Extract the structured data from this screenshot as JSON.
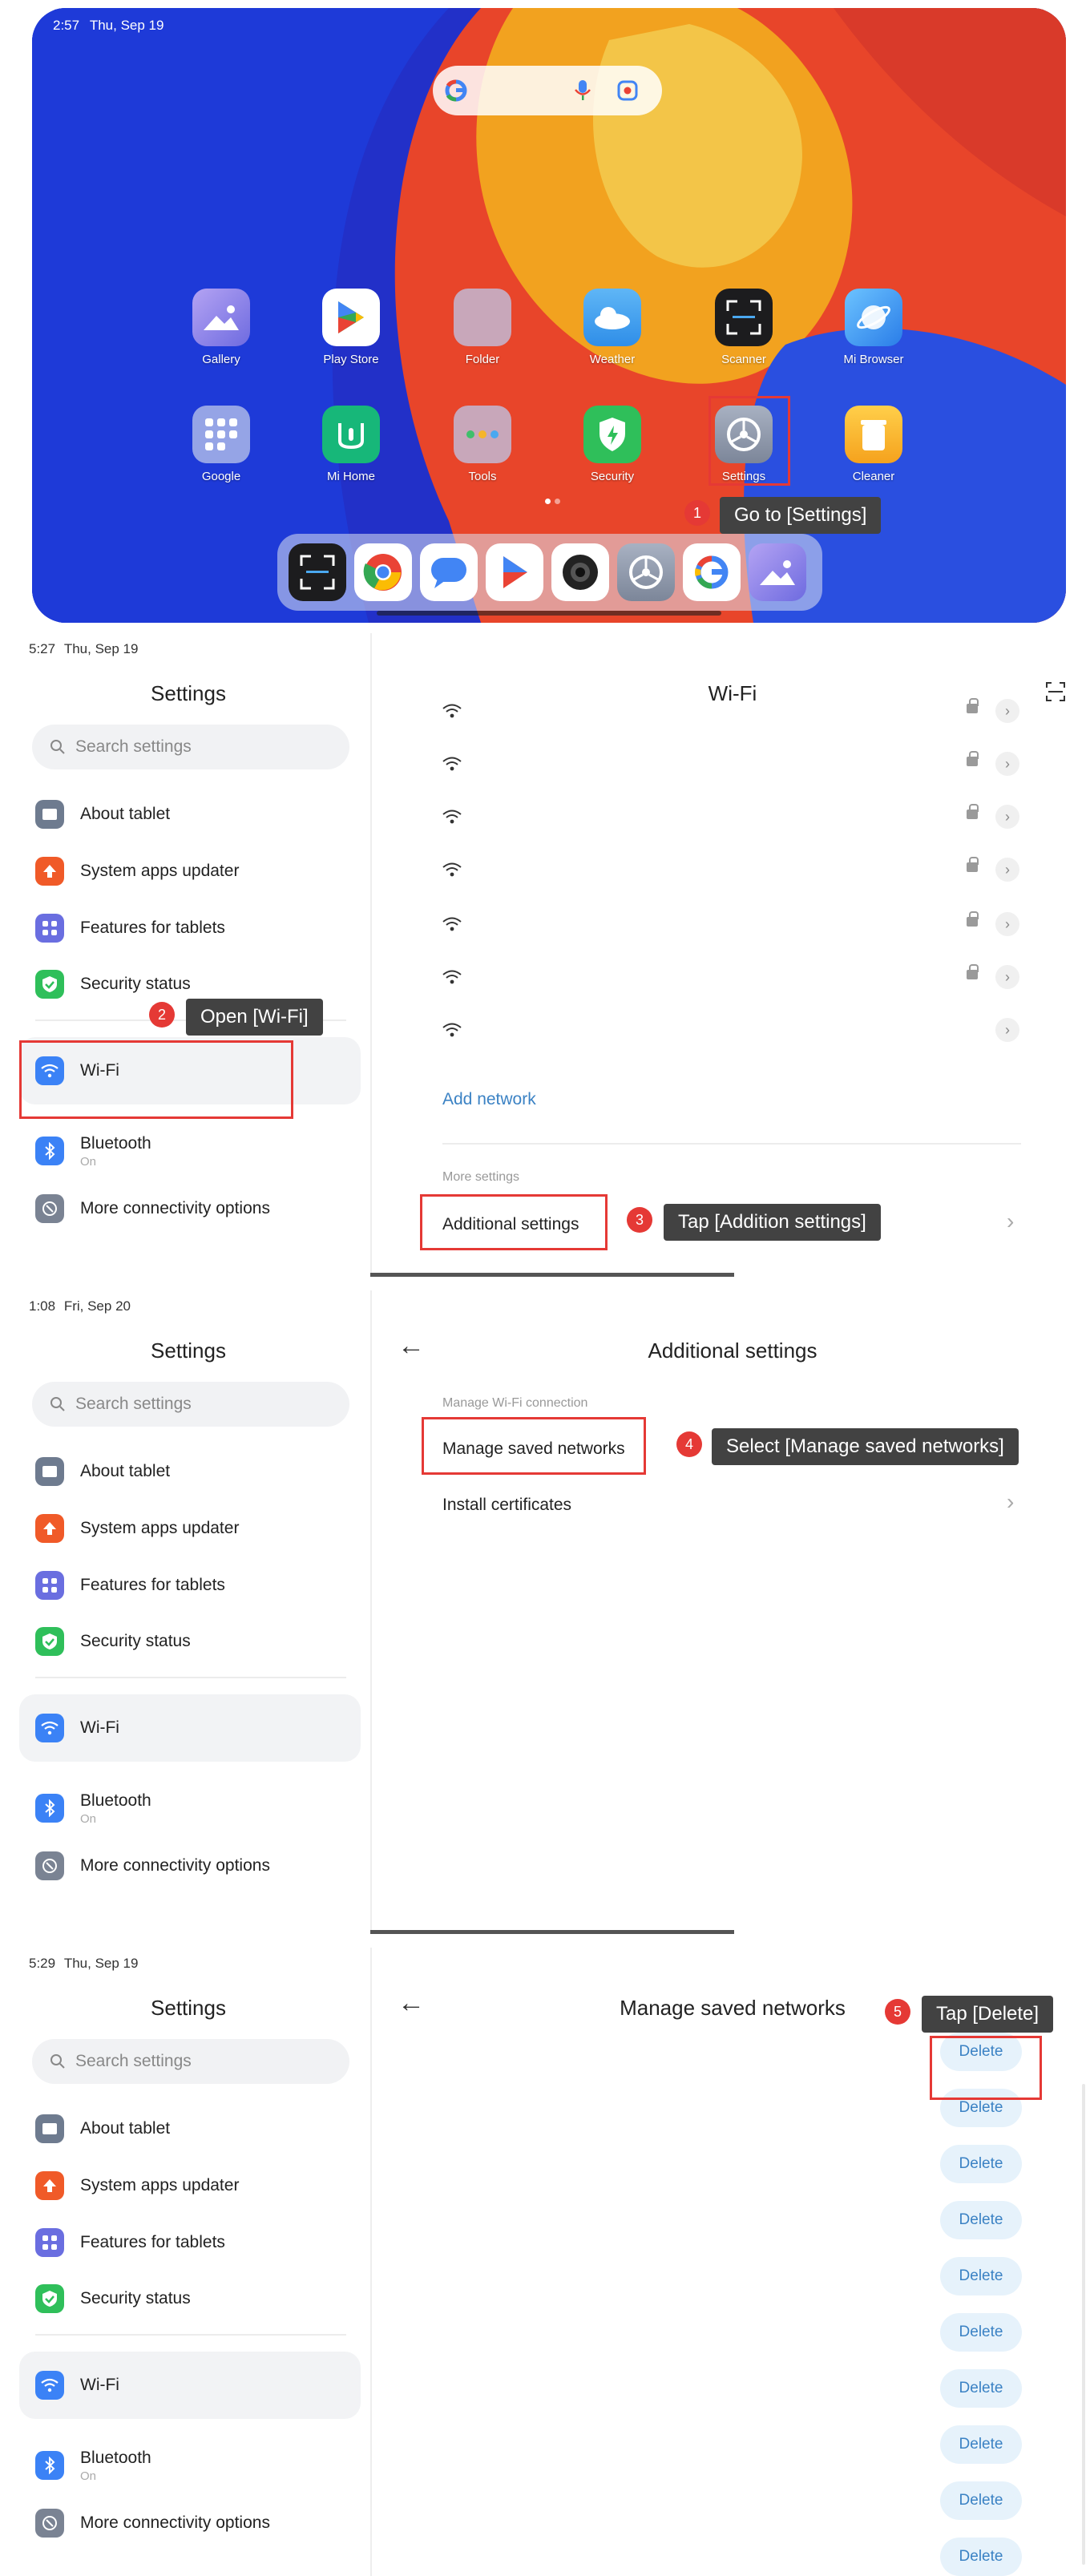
{
  "home": {
    "status_time": "2:57",
    "status_date": "Thu, Sep 19",
    "apps_row1": [
      {
        "label": "Gallery",
        "icon": "gallery-icon",
        "color": "#8e7bd9"
      },
      {
        "label": "Play Store",
        "icon": "play-store-icon",
        "color": "#ffffff"
      },
      {
        "label": "Folder",
        "icon": "folder-icon",
        "color": "#9aa6d6"
      },
      {
        "label": "Weather",
        "icon": "weather-icon",
        "color": "#4aa8f0"
      },
      {
        "label": "Scanner",
        "icon": "scanner-icon",
        "color": "#1d1d1d"
      },
      {
        "label": "Mi Browser",
        "icon": "browser-icon",
        "color": "#3d9cf5"
      }
    ],
    "apps_row2": [
      {
        "label": "Google",
        "icon": "google-folder-icon",
        "color": "#9aa6d6"
      },
      {
        "label": "Mi Home",
        "icon": "mi-home-icon",
        "color": "#18b87a"
      },
      {
        "label": "Tools",
        "icon": "tools-folder-icon",
        "color": "#9aa6d6"
      },
      {
        "label": "Security",
        "icon": "security-icon",
        "color": "#2fbf5a"
      },
      {
        "label": "Settings",
        "icon": "settings-gear-icon",
        "color": "#8d97a8"
      },
      {
        "label": "Cleaner",
        "icon": "cleaner-icon",
        "color": "#f5b52a"
      }
    ],
    "dock": [
      "scanner-icon",
      "chrome-icon",
      "messages-icon",
      "play-icon",
      "camera-icon",
      "settings-gear-icon",
      "google-icon",
      "gallery-icon"
    ]
  },
  "steps": {
    "s1": {
      "num": "1",
      "text": "Go to [Settings]"
    },
    "s2": {
      "num": "2",
      "text": "Open [Wi-Fi]"
    },
    "s3": {
      "num": "3",
      "text": "Tap [Addition settings]"
    },
    "s4": {
      "num": "4",
      "text": "Select [Manage saved networks]"
    },
    "s5": {
      "num": "5",
      "text": "Tap [Delete]"
    }
  },
  "sidebar": {
    "title": "Settings",
    "search_placeholder": "Search settings",
    "items": [
      {
        "label": "About tablet",
        "icon": "tablet-icon",
        "color": "#6e7b8f"
      },
      {
        "label": "System apps updater",
        "icon": "update-arrow-icon",
        "color": "#f05a28"
      },
      {
        "label": "Features for tablets",
        "icon": "grid-icon",
        "color": "#6a6ee0"
      },
      {
        "label": "Security status",
        "icon": "shield-check-icon",
        "color": "#2fbf5a"
      }
    ],
    "wifi": {
      "label": "Wi-Fi",
      "icon": "wifi-icon",
      "color": "#3b82f6"
    },
    "bluetooth": {
      "label": "Bluetooth",
      "sub": "On",
      "icon": "bluetooth-icon",
      "color": "#3b82f6"
    },
    "more": {
      "label": "More connectivity options",
      "icon": "link-icon",
      "color": "#7a8393"
    }
  },
  "panel2": {
    "time": "5:27",
    "date": "Thu, Sep 19",
    "title": "Wi-Fi",
    "add_network": "Add network",
    "more_settings": "More settings",
    "additional_settings": "Additional settings"
  },
  "panel3": {
    "time": "1:08",
    "date": "Fri, Sep 20",
    "title": "Additional settings",
    "section": "Manage Wi-Fi connection",
    "manage": "Manage saved networks",
    "install": "Install certificates"
  },
  "panel4": {
    "time": "5:29",
    "date": "Thu, Sep 19",
    "title": "Manage saved networks",
    "delete_label": "Delete"
  }
}
